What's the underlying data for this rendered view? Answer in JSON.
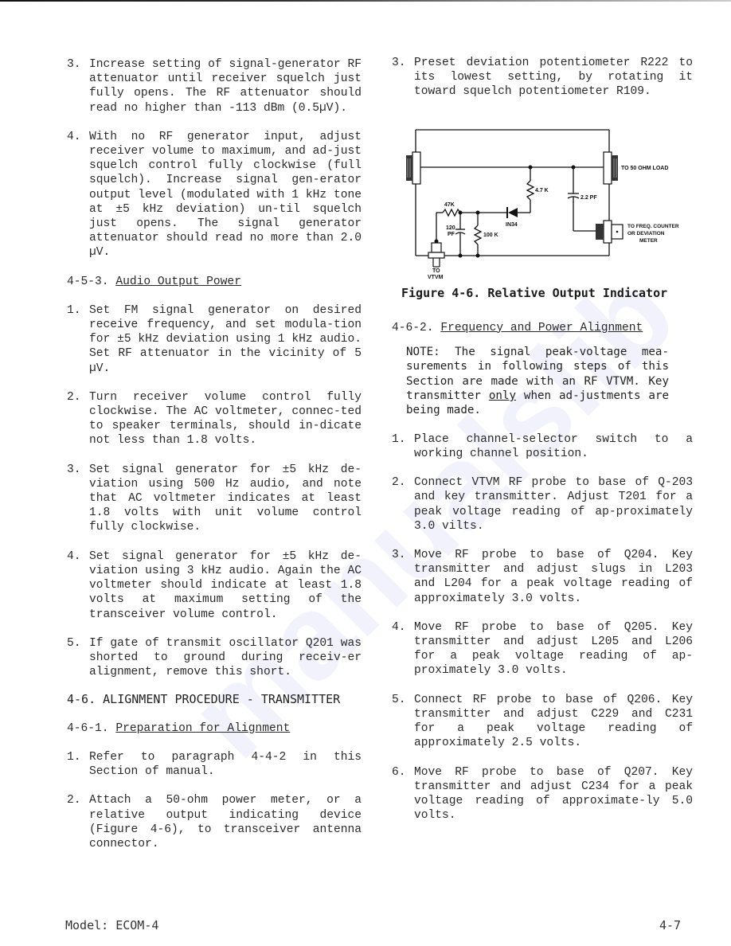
{
  "left_column": {
    "items_a": [
      {
        "num": "3.",
        "text": "Increase setting of signal-generator RF attenuator until receiver squelch just fully opens.  The RF attenuator should read no higher  than -113 dBm (0.5µV)."
      },
      {
        "num": "4.",
        "text": "With no RF generator  input,  adjust receiver volume to maximum,  and ad-just squelch control fully clockwise (full squelch). Increase signal gen-erator  output level (modulated with 1 kHz tone at  ±5 kHz deviation) un-til squelch  just opens.  The signal generator attenuator  should read no more than 2.0 µV."
      }
    ],
    "section_453": {
      "number": "4-5-3.",
      "title": "Audio Output Power"
    },
    "items_b": [
      {
        "num": "1.",
        "text": "Set FM signal generator  on  desired receive frequency,  and  set modula-tion for ±5 kHz  deviation  using  1 kHz audio.  Set RF attenuator in the vicinity of 5 µV."
      },
      {
        "num": "2.",
        "text": "Turn receiver volume  control  fully clockwise. The AC voltmeter, connec-ted to speaker terminals, should in-dicate not less than 1.8 volts."
      },
      {
        "num": "3.",
        "text": "Set signal generator for  ±5 kHz de-viation using 500 Hz audio, and note that AC voltmeter indicates at least 1.8 volts  with unit  volume control fully clockwise."
      },
      {
        "num": "4.",
        "text": "Set signal generator for ±5 kHz  de-viation using 3 kHz audio. Again the AC  voltmeter  should  indicate  at least 1.8 volts  at maximum  setting of the transceiver volume control."
      },
      {
        "num": "5.",
        "text": "If gate of transmit oscillator  Q201 was shorted to ground during receiv-er alignment, remove this short."
      }
    ],
    "section_46": "4-6. ALIGNMENT PROCEDURE - TRANSMITTER",
    "section_461": {
      "number": "4-6-1.",
      "title": "Preparation for Alignment"
    },
    "items_c": [
      {
        "num": "1.",
        "text": "Refer  to  paragraph  4-4-2  in this Section of manual."
      },
      {
        "num": "2.",
        "text": "Attach a 50-ohm power  meter,  or  a relative output  indicating  device (Figure 4-6), to transceiver antenna connector."
      }
    ]
  },
  "right_column": {
    "items_a": [
      {
        "num": "3.",
        "text": "Preset deviation  potentiometer R222 to its lowest setting,  by  rotating it toward squelch potentiometer R109."
      }
    ],
    "figure": {
      "caption": "Figure 4-6.  Relative Output Indicator",
      "labels": {
        "load": "TO 50 OHM LOAD",
        "r_47k_4": "4.7 K",
        "c_2p2": "2.2 PF",
        "r_47k": "47K",
        "diode": "IN34",
        "c_120_a": "120",
        "c_120_b": "PF",
        "r_100k": "100 K",
        "freq_1": "TO FREQ. COUNTER",
        "freq_2": "OR  DEVIATION",
        "freq_3": "METER",
        "vtvm_1": "TO",
        "vtvm_2": "VTVM"
      }
    },
    "section_462": {
      "number": "4-6-2.",
      "title": "Frequency and Power Alignment"
    },
    "note": {
      "before": "NOTE:  The signal peak-voltage mea-surements  in  following  steps  of this  Section  are made  with an RF VTVM. Key transmitter ",
      "emphasis": "only",
      "after": " when ad-justments are being made."
    },
    "items_b": [
      {
        "num": "1.",
        "text": "Place channel-selector  switch  to a working channel position."
      },
      {
        "num": "2.",
        "text": "Connect VTVM RF  probe to base of Q-203 and key transmitter. Adjust T201 for a peak voltage  reading  of  ap-proximately 3.0 vilts."
      },
      {
        "num": "3.",
        "text": "Move RF probe  to base of Q204.  Key transmitter and adjust slugs in L203 and L204 for  a peak voltage reading of approximately 3.0 volts."
      },
      {
        "num": "4.",
        "text": "Move RF  probe to base of Q205.  Key transmitter and adjust L205 and L206 for  a peak voltage  reading of  ap-proximately 3.0 volts."
      },
      {
        "num": "5.",
        "text": "Connect RF probe  to  base  of Q206. Key transmitter and adjust C229  and C231  for a peak  voltage reading of approximately 2.5 volts."
      },
      {
        "num": "6.",
        "text": "Move RF probe to  base of Q207.  Key transmitter  and  adjust  C234 for a peak voltage reading of approximate-ly 5.0 volts."
      }
    ]
  },
  "footer": {
    "model": "Model: ECOM-4",
    "page": "4-7"
  }
}
